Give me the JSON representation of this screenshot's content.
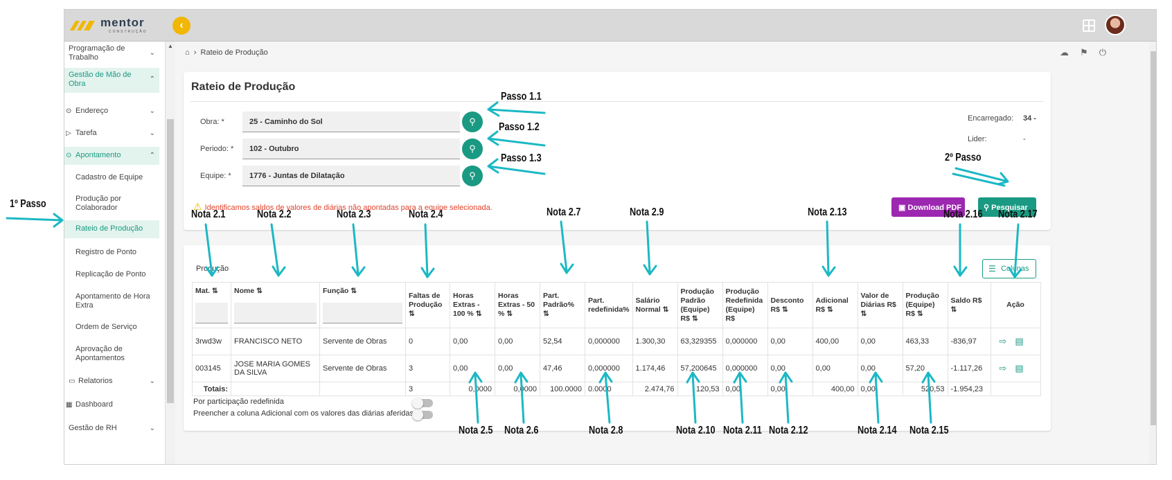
{
  "brand": {
    "name": "mentor",
    "sub": "CONSTRUÇÃO",
    "accent": "#1a9a82",
    "logo_color": "#f2b705"
  },
  "topbar": {
    "collapse_icon": "chevron-left-icon",
    "apps_icon": "grid-icon",
    "avatar_icon": "user-avatar"
  },
  "sidebar": {
    "items": [
      {
        "label": "Programação de Trabalho",
        "chevron": "⌄"
      },
      {
        "label": "Gestão de Mão de Obra",
        "chevron": "⌃"
      },
      {
        "label": "Endereço",
        "chevron": "⌄"
      },
      {
        "label": "Tarefa",
        "chevron": "⌄"
      },
      {
        "label": "Apontamento",
        "chevron": "⌃"
      },
      {
        "label": "Cadastro de Equipe"
      },
      {
        "label": "Produção por Colaborador"
      },
      {
        "label": "Rateio de Produção"
      },
      {
        "label": "Registro de Ponto"
      },
      {
        "label": "Replicação de Ponto"
      },
      {
        "label": "Apontamento de Hora Extra"
      },
      {
        "label": "Ordem de Serviço"
      },
      {
        "label": "Aprovação de Apontamentos"
      },
      {
        "label": "Relatorios",
        "chevron": "⌄"
      },
      {
        "label": "Dashboard"
      },
      {
        "label": "Gestão de RH",
        "chevron": "⌄"
      }
    ]
  },
  "breadcrumb": {
    "home_icon": "home-icon",
    "current": "Rateio de Produção"
  },
  "form": {
    "title": "Rateio de Produção",
    "obra_label": "Obra: *",
    "obra_value": "25 - Caminho do Sol",
    "periodo_label": "Periodo: *",
    "periodo_value": "102 - Outubro",
    "equipe_label": "Equipe: *",
    "equipe_value": "1776 - Juntas de Dilatação",
    "encarregado_label": "Encarregado:",
    "encarregado_value": "34 -",
    "lider_label": "Lider:",
    "lider_value": "-",
    "warning": "Identificamos saldos de valores de diárias não apontadas para a equipe selecionada.",
    "download_pdf": "Download PDF",
    "pesquisar": "Pesquisar"
  },
  "table": {
    "title": "Produção",
    "colunas_button": "Colunas",
    "headers": [
      "Mat. ⇅",
      "Nome ⇅",
      "Função ⇅",
      "Faltas de Produção ⇅",
      "Horas Extras - 100 % ⇅",
      "Horas Extras - 50 % ⇅",
      "Part. Padrão% ⇅",
      "Part. redefinida%",
      "Salário Normal ⇅",
      "Produção Padrão (Equipe) R$ ⇅",
      "Produção Redefinida (Equipe) R$",
      "Desconto R$ ⇅",
      "Adicional R$ ⇅",
      "Valor de Diárias R$ ⇅",
      "Produção (Equipe) R$ ⇅",
      "Saldo R$ ⇅",
      "Ação"
    ],
    "rows": [
      [
        "3rwd3w",
        "FRANCISCO NETO",
        "Servente de Obras",
        "0",
        "0,00",
        "0,00",
        "52,54",
        "0,000000",
        "1.300,30",
        "63,329355",
        "0,000000",
        "0,00",
        "400,00",
        "0,00",
        "463,33",
        "-836,97"
      ],
      [
        "003145",
        "JOSE MARIA GOMES DA SILVA",
        "Servente de Obras",
        "3",
        "0,00",
        "0,00",
        "47,46",
        "0,000000",
        "1.174,46",
        "57,200645",
        "0,000000",
        "0,00",
        "0,00",
        "0,00",
        "57,20",
        "-1.117,26"
      ]
    ],
    "totals": [
      "Totais:",
      "3",
      "0,0000",
      "0,0000",
      "100.0000",
      "0.0000",
      "2.474,76",
      "120,53",
      "0,00",
      "0,00",
      "400,00",
      "0,00",
      "520,53",
      "-1.954,23"
    ],
    "toggle1": "Por participação redefinida",
    "toggle2": "Preencher a coluna Adicional com os valores das diárias aferidas"
  },
  "annotations": {
    "passo_1_1": "Passo 1.1",
    "passo_1_2": "Passo 1.2",
    "passo_1_3": "Passo 1.3",
    "passo_2": "2º Passo",
    "passo_1": "1º Passo",
    "n21": "Nota 2.1",
    "n22": "Nota 2.2",
    "n23": "Nota 2.3",
    "n24": "Nota 2.4",
    "n27": "Nota 2.7",
    "n29": "Nota 2.9",
    "n213": "Nota 2.13",
    "n216": "Nota 2.16",
    "n217": "Nota 2.17",
    "n25": "Nota 2.5",
    "n26": "Nota 2.6",
    "n28": "Nota 2.8",
    "n210": "Nota 2.10",
    "n211": "Nota 2.11",
    "n212": "Nota 2.12",
    "n214": "Nota 2.14",
    "n215": "Nota 2.15",
    "arrow_color": "#1bb8c4"
  }
}
